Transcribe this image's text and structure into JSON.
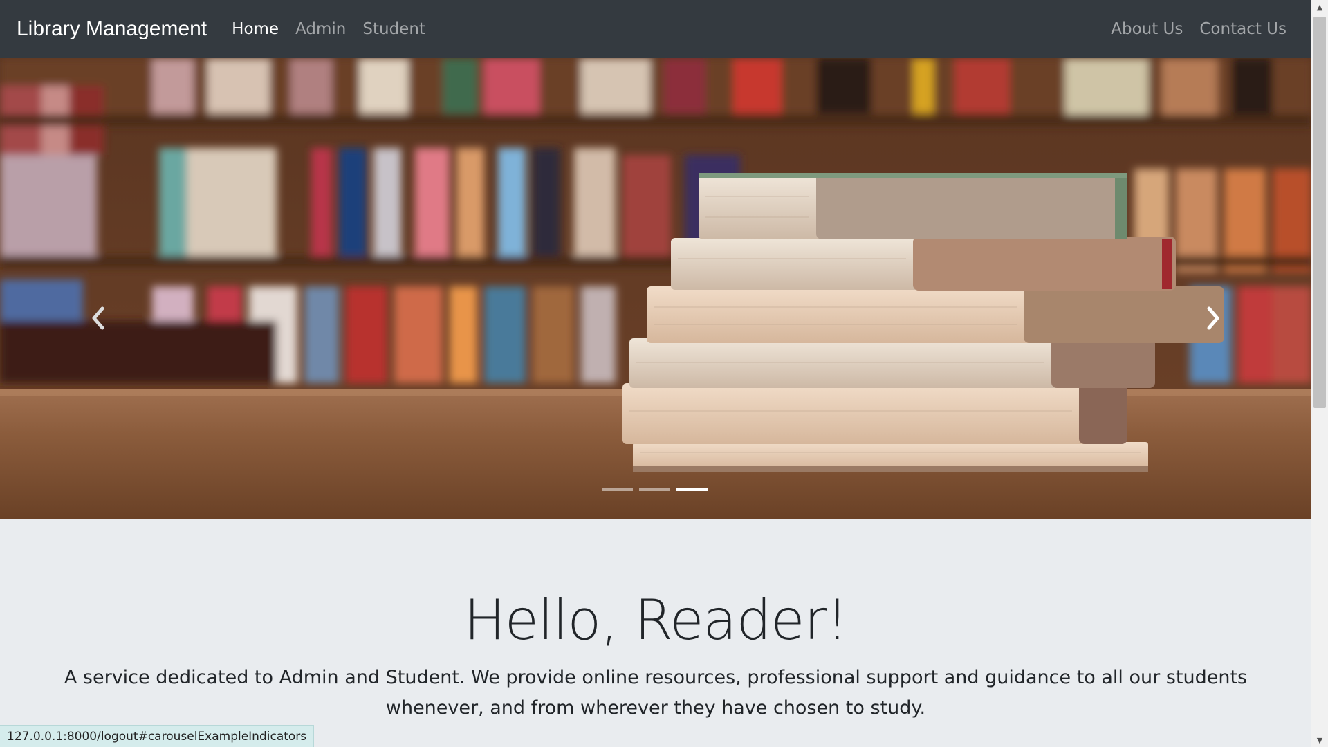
{
  "navbar": {
    "brand": "Library Management",
    "left_links": [
      "Home",
      "Admin",
      "Student"
    ],
    "right_links": [
      "About Us",
      "Contact Us"
    ]
  },
  "carousel": {
    "slide_count": 3,
    "active_index": 2
  },
  "jumbotron": {
    "heading": "Hello, Reader!",
    "lead": "A service dedicated to Admin and Student. We provide online resources, professional support and guidance to all our students whenever, and from wherever they have chosen to study."
  },
  "status_bar": {
    "url": "127.0.0.1:8000/logout#carouselExampleIndicators"
  }
}
